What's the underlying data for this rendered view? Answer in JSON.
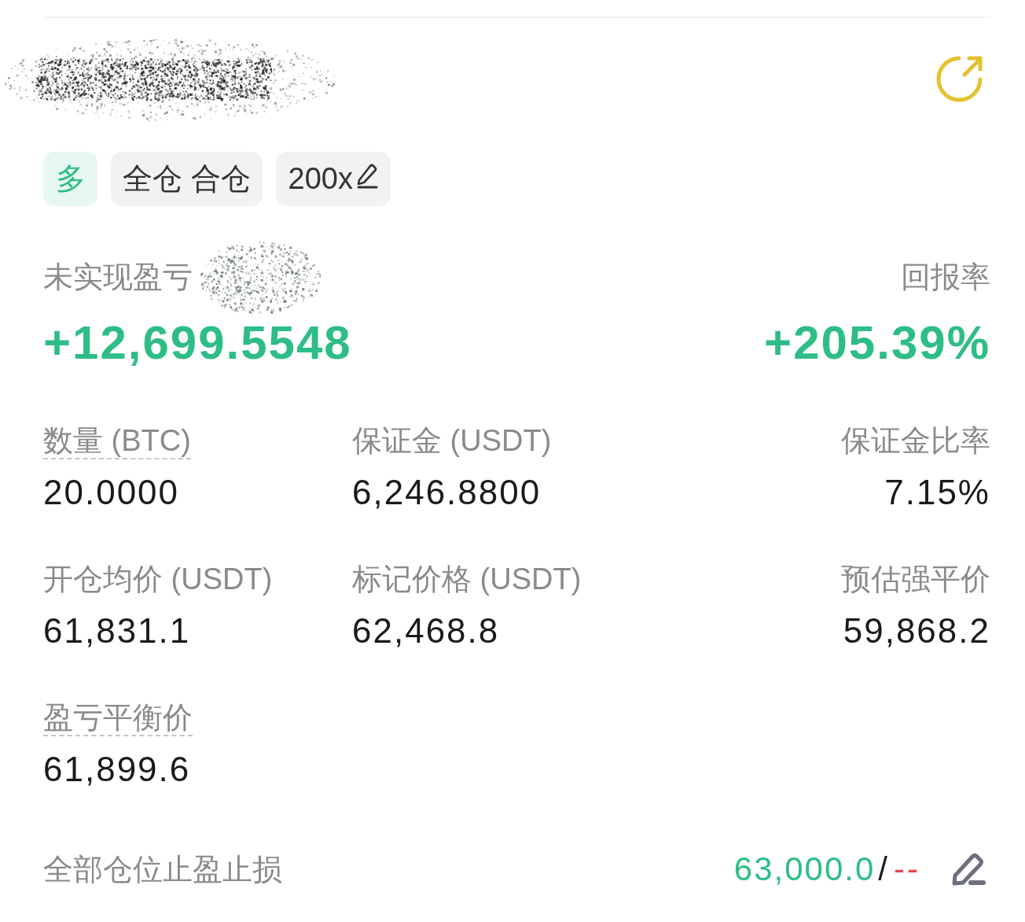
{
  "tags": [
    {
      "kind": "side",
      "label": "多",
      "editable": false
    },
    {
      "kind": "mode",
      "label": "全仓 合仓",
      "editable": false
    },
    {
      "kind": "leverage",
      "label": "200x",
      "editable": true
    }
  ],
  "pnl": {
    "label": "未实现盈亏",
    "value": "+12,699.5548",
    "positive": true
  },
  "roe": {
    "label": "回报率",
    "value": "+205.39%",
    "positive": true
  },
  "stats": [
    {
      "label": "数量 (BTC)",
      "value": "20.0000",
      "underlined": true
    },
    {
      "label": "保证金 (USDT)",
      "value": "6,246.8800",
      "underlined": false
    },
    {
      "label": "保证金比率",
      "value": "7.15%",
      "underlined": false
    },
    {
      "label": "开仓均价 (USDT)",
      "value": "61,831.1",
      "underlined": false
    },
    {
      "label": "标记价格 (USDT)",
      "value": "62,468.8",
      "underlined": false
    },
    {
      "label": "预估强平价",
      "value": "59,868.2",
      "underlined": false
    },
    {
      "label": "盈亏平衡价",
      "value": "61,899.6",
      "underlined": true
    }
  ],
  "tpsl": {
    "label": "全部仓位止盈止损",
    "take_profit": "63,000.0",
    "separator": "/",
    "stop_loss": "--",
    "editable": true
  }
}
